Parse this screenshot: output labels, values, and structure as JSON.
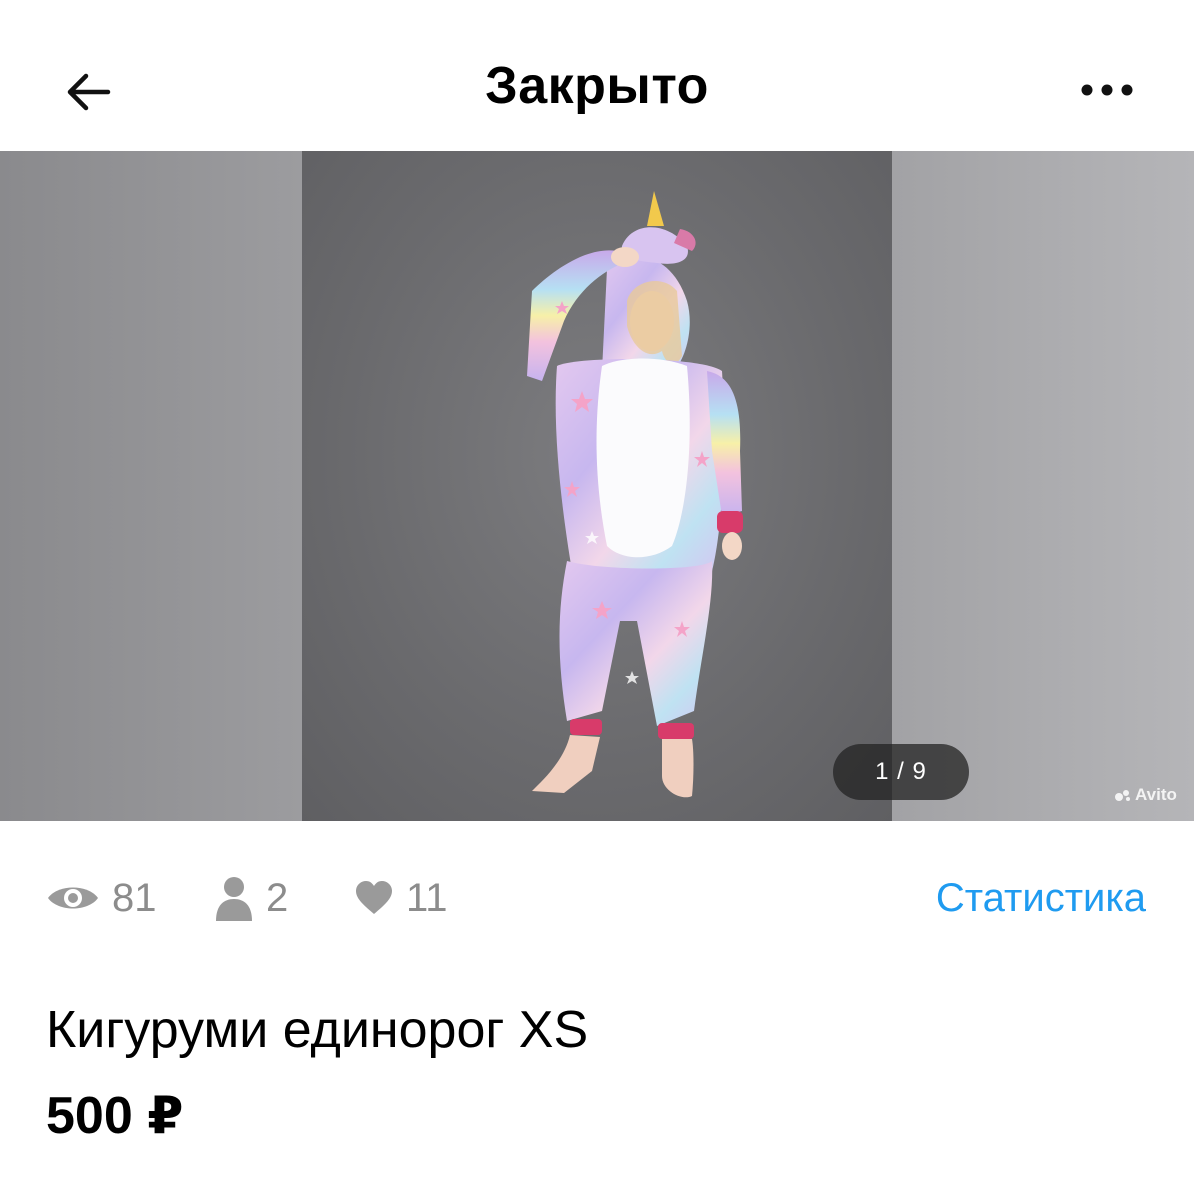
{
  "header": {
    "title": "Закрыто",
    "back_icon": "arrow-left-icon",
    "more_icon": "more-horizontal-icon"
  },
  "gallery": {
    "counter": "1 / 9",
    "watermark": "Avito"
  },
  "stats": {
    "views": "81",
    "contacts": "2",
    "favorites": "11",
    "link_label": "Статистика",
    "icon_color": "#9a9a9a",
    "link_color": "#1f9bf0"
  },
  "product": {
    "title": "Кигуруми единорог XS",
    "price": "500 ₽"
  }
}
